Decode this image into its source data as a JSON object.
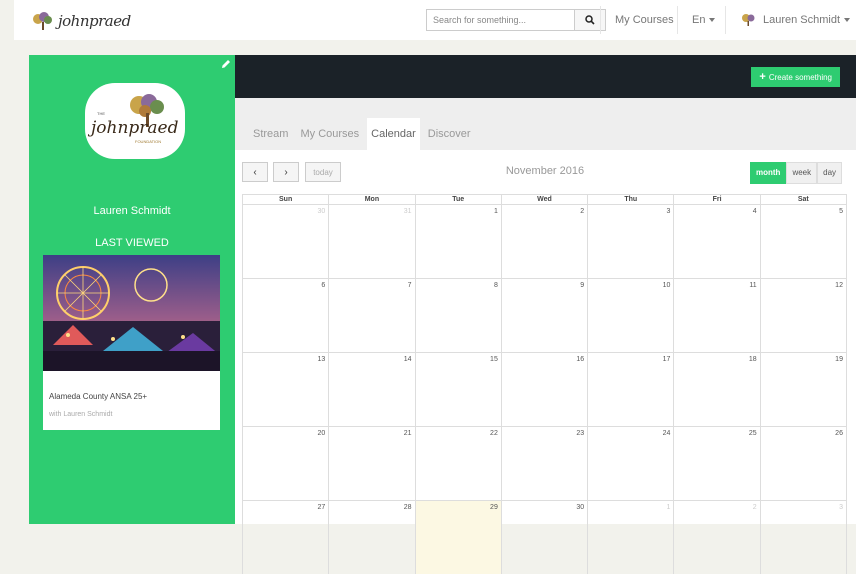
{
  "brand": {
    "logo_text": "johnpraed",
    "logo_small_caption": "FOUNDATION",
    "logo_big_prefix": "THE",
    "logo_big_caption": "FOUNDATION"
  },
  "topbar": {
    "search_placeholder": "Search for something...",
    "search_icon": "magnifier-icon",
    "my_courses": "My Courses",
    "language": "En",
    "user_name": "Lauren Schmidt"
  },
  "sidebar": {
    "user_name": "Lauren Schmidt",
    "last_viewed_label": "LAST VIEWED",
    "card": {
      "title": "Alameda County ANSA 25+",
      "subtitle": "with Lauren Schmidt"
    },
    "edit_icon": "pencil-icon"
  },
  "header": {
    "create_button": "Create something",
    "create_icon": "plus-icon"
  },
  "tabs": [
    {
      "label": "Stream",
      "active": false
    },
    {
      "label": "My Courses",
      "active": false
    },
    {
      "label": "Calendar",
      "active": true
    },
    {
      "label": "Discover",
      "active": false
    }
  ],
  "calendar": {
    "title": "November 2016",
    "prev": "‹",
    "next": "›",
    "today_button": "today",
    "views": [
      {
        "label": "month",
        "active": true
      },
      {
        "label": "week",
        "active": false
      },
      {
        "label": "day",
        "active": false
      }
    ],
    "weekdays": [
      "Sun",
      "Mon",
      "Tue",
      "Wed",
      "Thu",
      "Fri",
      "Sat"
    ],
    "weeks": [
      [
        "30",
        "31",
        "1",
        "2",
        "3",
        "4",
        "5"
      ],
      [
        "6",
        "7",
        "8",
        "9",
        "10",
        "11",
        "12"
      ],
      [
        "13",
        "14",
        "15",
        "16",
        "17",
        "18",
        "19"
      ],
      [
        "20",
        "21",
        "22",
        "23",
        "24",
        "25",
        "26"
      ],
      [
        "27",
        "28",
        "29",
        "30",
        "1",
        "2",
        "3"
      ]
    ],
    "other_month": [
      [
        true,
        true,
        false,
        false,
        false,
        false,
        false
      ],
      [
        false,
        false,
        false,
        false,
        false,
        false,
        false
      ],
      [
        false,
        false,
        false,
        false,
        false,
        false,
        false
      ],
      [
        false,
        false,
        false,
        false,
        false,
        false,
        false
      ],
      [
        false,
        false,
        false,
        false,
        true,
        true,
        true
      ]
    ],
    "today": [
      4,
      2
    ]
  },
  "colors": {
    "accent": "#2ecc71",
    "dark": "#1b2228",
    "today": "#fcf8e3"
  }
}
